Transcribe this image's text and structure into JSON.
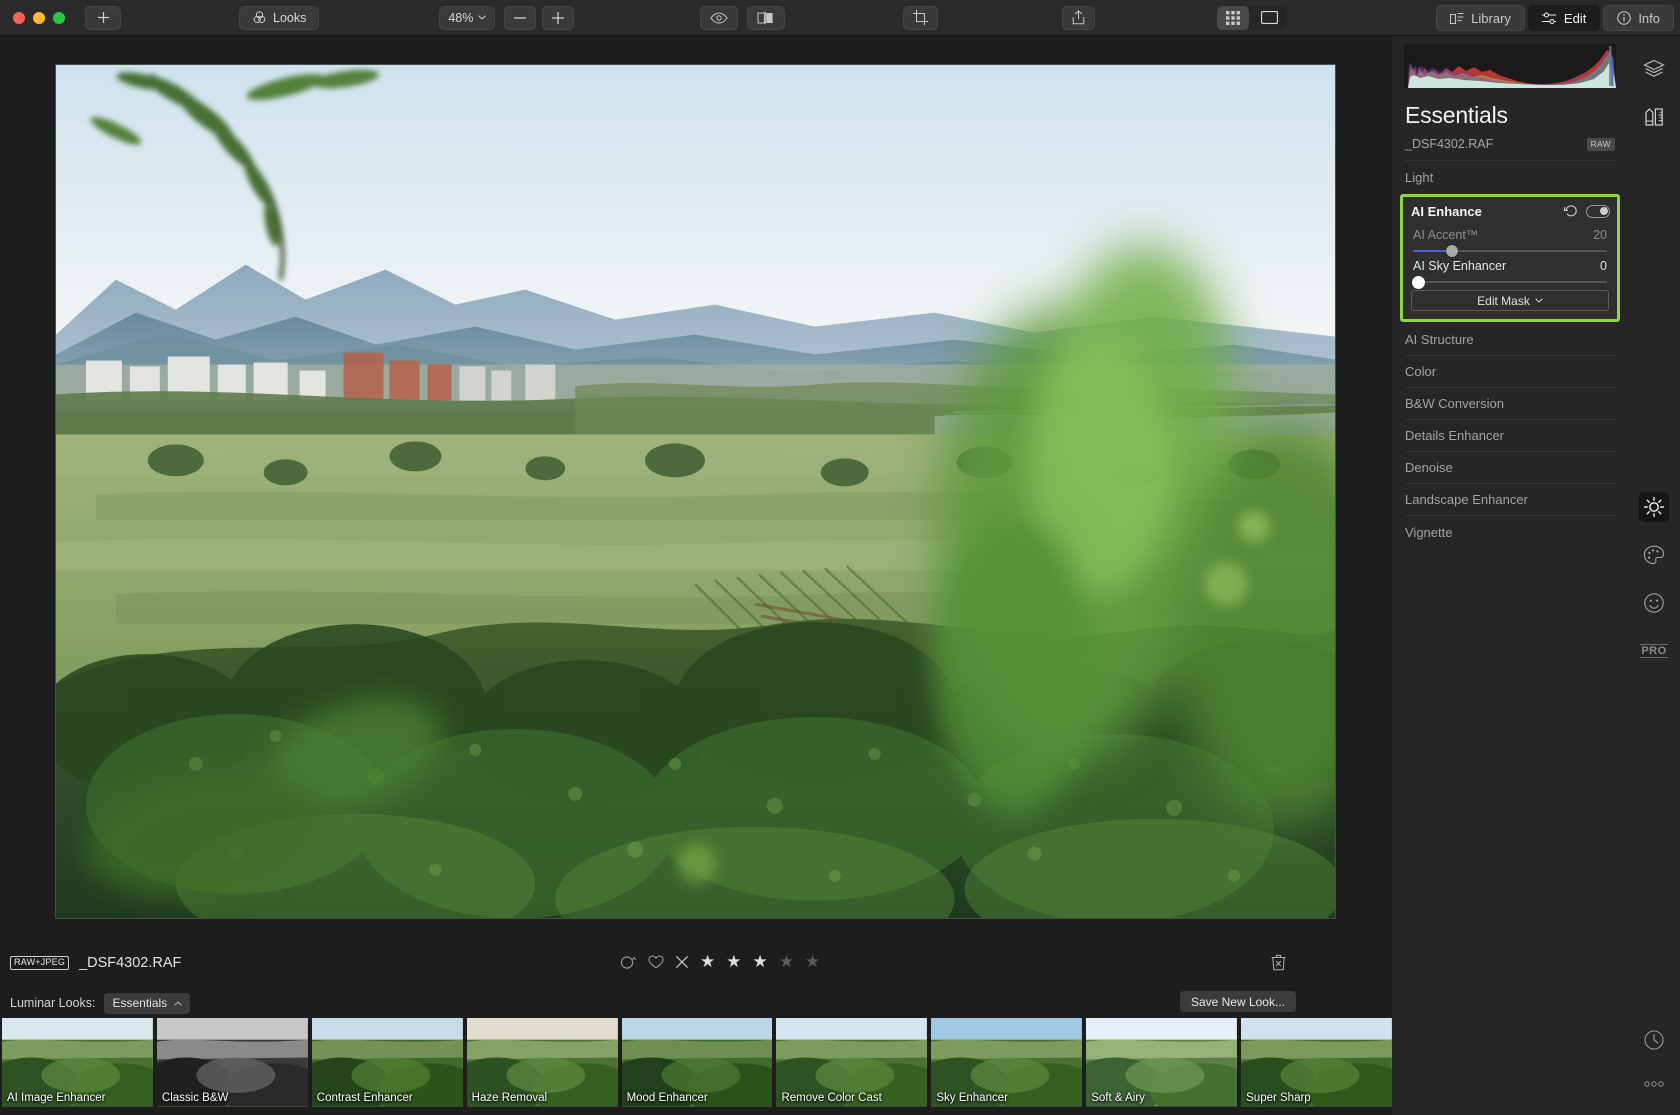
{
  "window": {
    "traffic_lights": [
      "close",
      "minimize",
      "zoom"
    ]
  },
  "toolbar": {
    "add_label": "+",
    "looks_label": "Looks",
    "zoom_value": "48%",
    "zoom_out_label": "−",
    "zoom_in_label": "+",
    "icons": {
      "looks": "looks-icon",
      "preview_eye": "eye-icon",
      "compare": "compare-split-icon",
      "crop": "crop-icon",
      "share": "share-icon",
      "grid_view": "grid-view-icon",
      "single_view": "single-view-icon"
    },
    "modes": [
      {
        "label": "Library",
        "icon": "library-icon",
        "active": false
      },
      {
        "label": "Edit",
        "icon": "edit-sliders-icon",
        "active": true
      },
      {
        "label": "Info",
        "icon": "info-icon",
        "active": false
      }
    ]
  },
  "info_bar": {
    "format_badge": "RAW+JPEG",
    "filename": "_DSF4302.RAF",
    "flag_icon": "reject-circle-icon",
    "like_icon": "heart-icon",
    "reject_icon": "x-icon",
    "rating": 3,
    "rating_max": 5,
    "trash_icon": "trash-icon"
  },
  "looks_bar": {
    "label": "Luminar Looks:",
    "collection": "Essentials",
    "chevron": "chevron-up-icon",
    "save_label": "Save New Look..."
  },
  "filmstrip": {
    "items": [
      {
        "label": "AI Image Enhancer",
        "style": "normal"
      },
      {
        "label": "Classic B&W",
        "style": "bw"
      },
      {
        "label": "Contrast Enhancer",
        "style": "contrast"
      },
      {
        "label": "Haze Removal",
        "style": "haze"
      },
      {
        "label": "Mood Enhancer",
        "style": "mood"
      },
      {
        "label": "Remove Color Cast",
        "style": "cast"
      },
      {
        "label": "Sky Enhancer",
        "style": "sky"
      },
      {
        "label": "Soft & Airy",
        "style": "soft"
      },
      {
        "label": "Super Sharp",
        "style": "sharp"
      }
    ]
  },
  "right_panel": {
    "histogram_name": "histogram",
    "title": "Essentials",
    "filename": "_DSF4302.RAF",
    "file_badge": "RAW",
    "items_above": [
      {
        "label": "Light"
      }
    ],
    "ai_enhance": {
      "title": "AI Enhance",
      "reset_icon": "reset-arrow-icon",
      "toggle_icon": "toggle-switch-on",
      "highlight_color": "#8ed54a",
      "sliders": [
        {
          "label": "AI Accent™",
          "value": "20",
          "percent": 20,
          "state": "dim"
        },
        {
          "label": "AI Sky Enhancer",
          "value": "0",
          "percent": 0,
          "state": "lit"
        }
      ],
      "edit_mask_label": "Edit Mask",
      "edit_mask_chevron": "chevron-down-icon"
    },
    "items_below": [
      {
        "label": "AI Structure"
      },
      {
        "label": "Color"
      },
      {
        "label": "B&W Conversion"
      },
      {
        "label": "Details Enhancer"
      },
      {
        "label": "Denoise"
      },
      {
        "label": "Landscape Enhancer"
      },
      {
        "label": "Vignette"
      }
    ]
  },
  "rail": {
    "items": [
      {
        "name": "layers-icon",
        "active": false
      },
      {
        "name": "tools-pencil-ruler-icon",
        "active": false
      },
      {
        "name": "essentials-sun-icon",
        "active": true
      },
      {
        "name": "creative-palette-icon",
        "active": false
      },
      {
        "name": "portrait-face-icon",
        "active": false
      },
      {
        "name": "pro-label",
        "active": false
      }
    ],
    "pro_label": "PRO",
    "history_icon": "history-clock-icon",
    "more_icon": "more-dots-icon"
  }
}
